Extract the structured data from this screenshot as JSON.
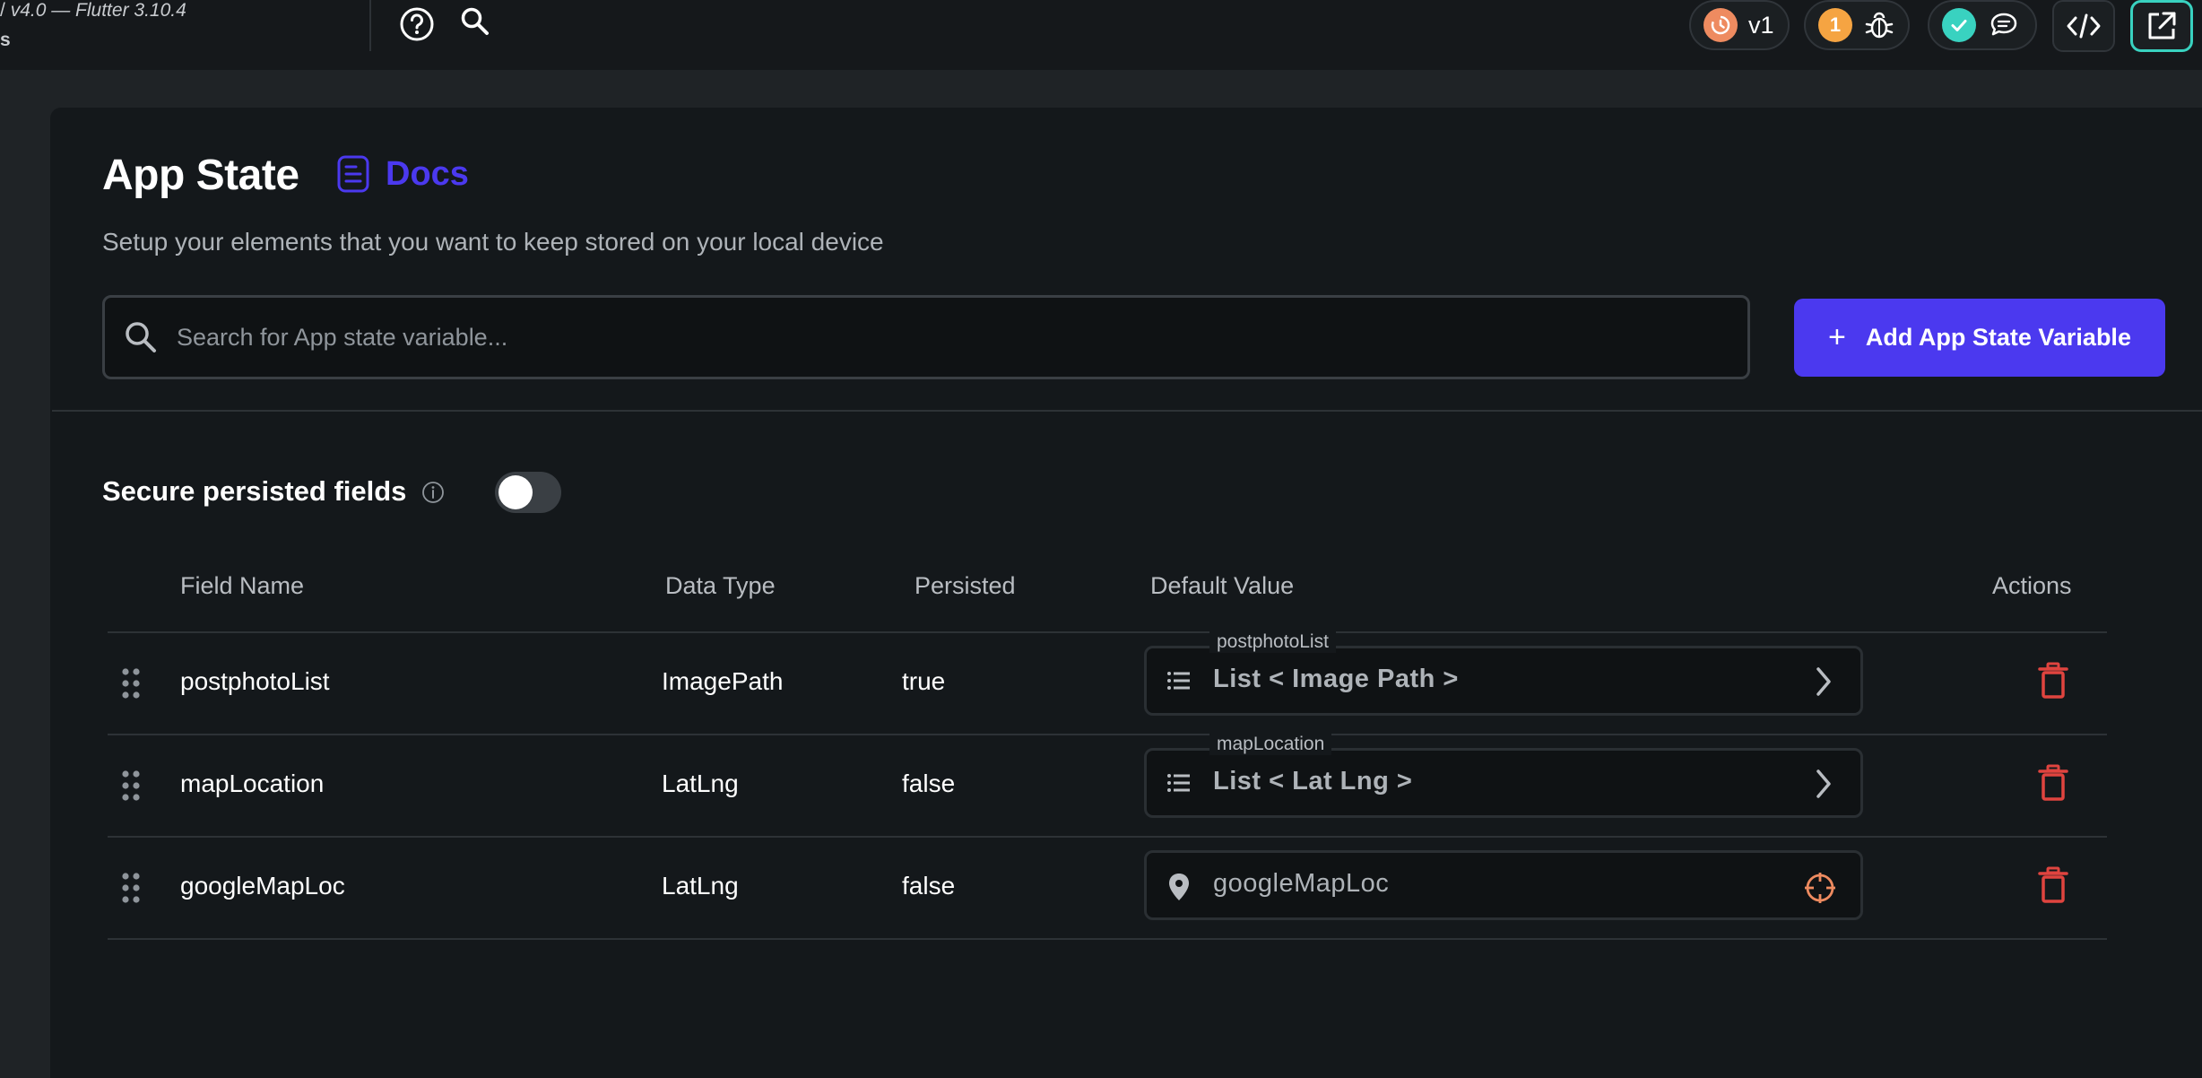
{
  "topbar": {
    "version_text": "v4.0 — Flutter 3.10.4",
    "version_prefix": "/",
    "project_fragment": "s",
    "version_badge": "v1",
    "issues_count": "1"
  },
  "page": {
    "title": "App State",
    "docs_label": "Docs",
    "subtitle": "Setup your elements that you want to keep stored on your local device",
    "search_placeholder": "Search for App state variable...",
    "add_button_label": "Add App State Variable",
    "add_button_icon": "+",
    "secure_label": "Secure persisted fields",
    "secure_enabled": false
  },
  "table": {
    "headers": {
      "field_name": "Field Name",
      "data_type": "Data Type",
      "persisted": "Persisted",
      "default_value": "Default Value",
      "actions": "Actions"
    },
    "rows": [
      {
        "field_name": "postphotoList",
        "data_type": "ImagePath",
        "persisted": "true",
        "default_legend": "postphotoList",
        "default_text": "List < Image Path >",
        "default_icon": "list-icon",
        "trail_icon": "chevron-right-icon"
      },
      {
        "field_name": "mapLocation",
        "data_type": "LatLng",
        "persisted": "false",
        "default_legend": "mapLocation",
        "default_text": "List < Lat Lng >",
        "default_icon": "list-icon",
        "trail_icon": "chevron-right-icon"
      },
      {
        "field_name": "googleMapLoc",
        "data_type": "LatLng",
        "persisted": "false",
        "default_legend": "",
        "default_text": "googleMapLoc",
        "default_icon": "location-pin-icon",
        "trail_icon": "crosshair-icon"
      }
    ]
  },
  "colors": {
    "accent": "#4b39ef",
    "delete": "#e0443f",
    "success": "#39d2c0",
    "warning": "#f5a442",
    "version": "#ee8b60"
  }
}
